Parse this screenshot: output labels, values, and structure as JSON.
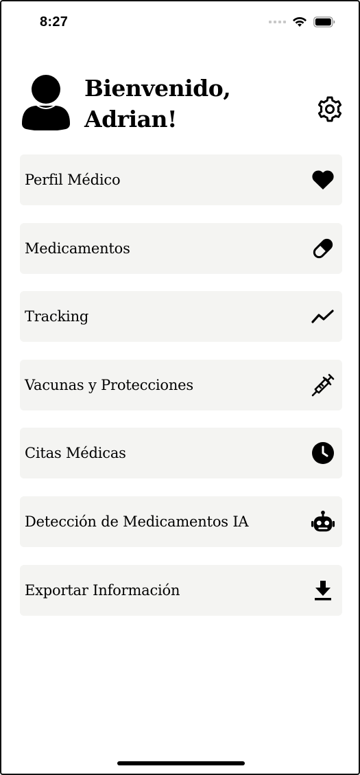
{
  "status_bar": {
    "time": "8:27"
  },
  "header": {
    "greeting_line1": "Bienvenido,",
    "greeting_line2": "Adrian!",
    "avatar_icon": "user-icon",
    "settings_icon": "gear-icon"
  },
  "menu": {
    "items": [
      {
        "label": "Perfil Médico",
        "icon": "heart-icon"
      },
      {
        "label": "Medicamentos",
        "icon": "pill-icon"
      },
      {
        "label": "Tracking",
        "icon": "trend-line-icon"
      },
      {
        "label": "Vacunas y Protecciones",
        "icon": "syringe-icon"
      },
      {
        "label": "Citas Médicas",
        "icon": "clock-icon"
      },
      {
        "label": "Detección de Medicamentos IA",
        "icon": "robot-icon"
      },
      {
        "label": "Exportar Información",
        "icon": "download-icon"
      }
    ]
  },
  "colors": {
    "background": "#ffffff",
    "card": "#f4f4f2",
    "text": "#000000"
  }
}
